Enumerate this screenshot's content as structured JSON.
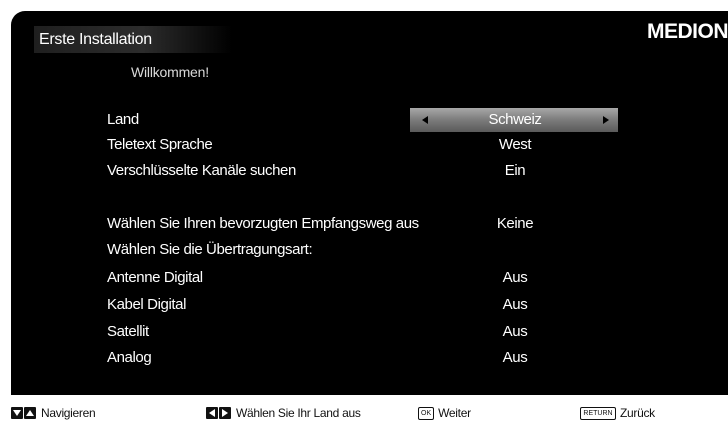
{
  "header": {
    "title": "Erste Installation",
    "brand": "MEDION"
  },
  "welcome": "Willkommen!",
  "settings": [
    {
      "label": "Land",
      "value": "Schweiz",
      "selected": true
    },
    {
      "label": "Teletext Sprache",
      "value": "West"
    },
    {
      "label": "Verschlüsselte Kanäle suchen",
      "value": "Ein"
    },
    {
      "label": "Wählen Sie Ihren bevorzugten Empfangsweg aus",
      "value": "Keine"
    },
    {
      "label": "Wählen Sie die Übertragungsart:",
      "value": ""
    },
    {
      "label": "Antenne Digital",
      "value": "Aus"
    },
    {
      "label": "Kabel Digital",
      "value": "Aus"
    },
    {
      "label": "Satellit",
      "value": "Aus"
    },
    {
      "label": "Analog",
      "value": "Aus"
    }
  ],
  "footer": {
    "navigate": "Navigieren",
    "select_country": "Wählen Sie Ihr Land aus",
    "ok_key": "OK",
    "next": "Weiter",
    "return_key": "RETURN",
    "back": "Zurück"
  },
  "colors": {
    "background": "#000000",
    "selection": "#8c8c8c",
    "footer": "#ffffff"
  }
}
